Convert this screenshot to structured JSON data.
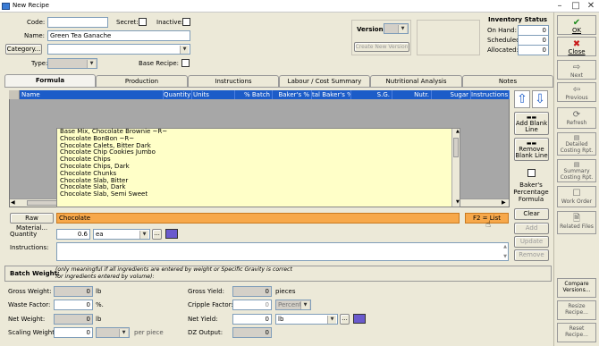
{
  "window": {
    "title": "New Recipe"
  },
  "header": {
    "code_label": "Code:",
    "code_value": "",
    "secret_label": "Secret:",
    "inactive_label": "Inactive:",
    "name_label": "Name:",
    "name_value": "Green Tea Ganache",
    "category_button": "Category...",
    "category_value": "",
    "type_label": "Type:",
    "type_value": "",
    "base_recipe_label": "Base Recipe:",
    "version_label": "Version:",
    "version_value": "",
    "create_version_button": "Create New Version"
  },
  "inventory": {
    "title": "Inventory Status",
    "on_hand_label": "On Hand:",
    "on_hand": "0",
    "scheduled_label": "Scheduled:",
    "scheduled": "0",
    "allocated_label": "Allocated:",
    "allocated": "0"
  },
  "sidebar": {
    "ok": "OK",
    "close": "Close",
    "next": "Next",
    "previous": "Previous",
    "refresh": "Refresh",
    "detailed": "Detailed Costing Rpt.",
    "summary": "Summary Costing Rpt.",
    "work_order": "Work Order",
    "related_files": "Related Files",
    "compare": "Compare Versions...",
    "resize": "Resize Recipe...",
    "reset": "Reset Recipe..."
  },
  "tabs": [
    "Formula",
    "Production",
    "Instructions",
    "Labour / Cost Summary",
    "Nutritional Analysis",
    "Notes"
  ],
  "grid": {
    "columns": [
      "Name",
      "Quantity",
      "Units",
      "% Batch",
      "Baker's %",
      "tal Baker's %",
      "S.G.",
      "Nutr.",
      "Sugar",
      "Instructions"
    ]
  },
  "dropdown_list": [
    "Base Mix, Chocolate Brownie ~R~",
    "Chocolate BonBon ~R~",
    "Chocolate Calets, Bitter Dark",
    "Chocolate Chip Cookies Jumbo",
    "Chocolate Chips",
    "Chocolate Chips, Dark",
    "Chocolate Chunks",
    "Chocolate Slab, Bitter",
    "Chocolate Slab, Dark",
    "Chocolate Slab, Semi Sweet"
  ],
  "right_tools": {
    "add_blank": "Add Blank Line",
    "remove_blank": "Remove Blank Line",
    "bakers_pct": "Baker's Percentage Formula",
    "clear": "Clear",
    "add": "Add",
    "update": "Update",
    "remove": "Remove"
  },
  "material": {
    "button": "Raw Material...",
    "value": "Chocolate",
    "hint": "F2 = List"
  },
  "quantity": {
    "label": "Quantity",
    "value": "0.6",
    "unit": "ea",
    "instructions_label": "Instructions:"
  },
  "batch": {
    "label": "Batch Weight:",
    "note": "(only meaningful if all ingredients are entered by weight or Specific Gravity is correct for ingredients entered by volume):"
  },
  "batch_fields": {
    "gross_weight_label": "Gross Weight:",
    "gross_weight": "0",
    "gross_weight_unit": "lb",
    "waste_factor_label": "Waste Factor:",
    "waste_factor": "0",
    "waste_factor_unit": "%.",
    "net_weight_label": "Net Weight:",
    "net_weight": "0",
    "net_weight_unit": "lb",
    "scaling_weight_label": "Scaling Weight:",
    "scaling_weight": "0",
    "per_piece": "per piece",
    "gross_yield_label": "Gross Yield:",
    "gross_yield": "0",
    "gross_yield_unit": "pieces",
    "cripple_label": "Cripple Factor:",
    "cripple": "0",
    "cripple_unit": "Percent",
    "net_yield_label": "Net Yield:",
    "net_yield": "0",
    "net_yield_unit": "lb",
    "dz_output_label": "DZ Output:",
    "dz_output": "0"
  }
}
